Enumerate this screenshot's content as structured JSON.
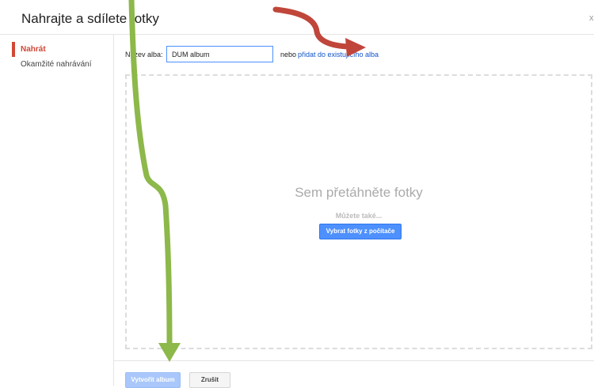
{
  "dialog": {
    "title": "Nahrajte a sdílete fotky",
    "close_glyph": "x"
  },
  "sidebar": {
    "items": [
      {
        "label": "Nahrát",
        "active": true
      },
      {
        "label": "Okamžité nahrávání",
        "active": false
      }
    ]
  },
  "album": {
    "label": "Název alba:",
    "value": "DUM album",
    "or_text": "nebo",
    "existing_link": "přidat do existujícího alba"
  },
  "dropzone": {
    "heading": "Sem přetáhněte fotky",
    "also": "Můžete také...",
    "select_button": "Vybrat fotky z počítače"
  },
  "footer": {
    "create_button": "Vytvořit album",
    "cancel_button": "Zrušit"
  },
  "annotations": {
    "green_arrow_color": "#8db84a",
    "red_arrow_color": "#c0463b"
  },
  "colors": {
    "accent_blue": "#4d90fe",
    "active_red": "#d14836",
    "link_blue": "#1155cc"
  }
}
